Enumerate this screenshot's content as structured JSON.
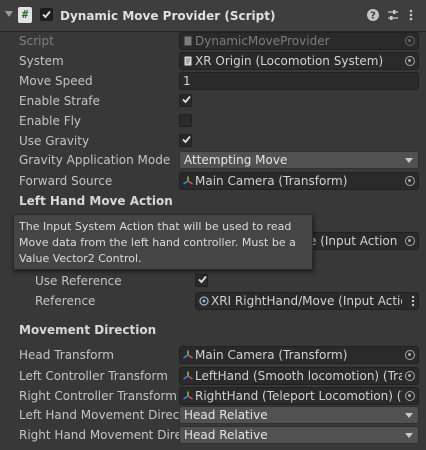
{
  "header": {
    "icon_glyph": "#",
    "enabled": true,
    "title": "Dynamic Move Provider (Script)"
  },
  "fields": {
    "script": {
      "label": "Script",
      "value": "DynamicMoveProvider"
    },
    "system": {
      "label": "System",
      "value": "XR Origin (Locomotion System)"
    },
    "move_speed": {
      "label": "Move Speed",
      "value": "1"
    },
    "enable_strafe": {
      "label": "Enable Strafe",
      "checked": true
    },
    "enable_fly": {
      "label": "Enable Fly",
      "checked": false
    },
    "use_gravity": {
      "label": "Use Gravity",
      "checked": true
    },
    "gravity_mode": {
      "label": "Gravity Application Mode",
      "value": "Attempting Move"
    },
    "forward_source": {
      "label": "Forward Source",
      "value": "Main Camera (Transform)"
    }
  },
  "left_hand": {
    "title": "Left Hand Move Action",
    "partial_value": "e (Input Action R",
    "tooltip": {
      "line1": "The Input System Action that will be used to read",
      "line2": "Move data from the left hand controller. Must be a",
      "line3": "Value Vector2 Control."
    }
  },
  "right_hand": {
    "use_reference": {
      "label": "Use Reference",
      "checked": true
    },
    "reference": {
      "label": "Reference",
      "value": "XRI RightHand/Move (Input Action"
    }
  },
  "movement_direction": {
    "title": "Movement Direction",
    "head_transform": {
      "label": "Head Transform",
      "value": "Main Camera (Transform)"
    },
    "left_controller": {
      "label": "Left Controller Transform",
      "value": "LeftHand (Smooth locomotion) (Trans"
    },
    "right_controller": {
      "label": "Right Controller Transform",
      "value": "RightHand (Teleport Locomotion) (Tra"
    },
    "left_movement": {
      "label": "Left Hand Movement Directi",
      "value": "Head Relative"
    },
    "right_movement": {
      "label": "Right Hand Movement Direc",
      "value": "Head Relative"
    }
  },
  "colors": {
    "background": "#383838",
    "field": "#2a2a2a",
    "dropdown": "#515151",
    "tooltip": "#454545",
    "text": "#d2d2d2"
  }
}
